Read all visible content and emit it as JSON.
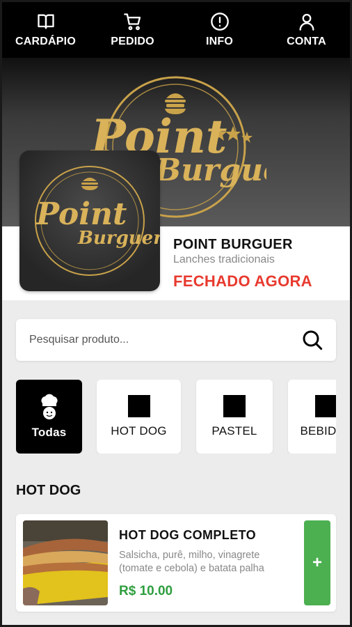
{
  "nav": [
    {
      "label": "CARDÁPIO",
      "icon": "book-icon"
    },
    {
      "label": "PEDIDO",
      "icon": "cart-icon"
    },
    {
      "label": "INFO",
      "icon": "info-icon"
    },
    {
      "label": "CONTA",
      "icon": "user-icon"
    }
  ],
  "logo": {
    "line1": "Point",
    "line2": "Burguer"
  },
  "store": {
    "name": "POINT BURGUER",
    "subtitle": "Lanches tradicionais",
    "status": "FECHADO AGORA",
    "status_color": "#e83a2f"
  },
  "search": {
    "placeholder": "Pesquisar produto..."
  },
  "categories": [
    {
      "label": "Todas",
      "active": true
    },
    {
      "label": "HOT DOG",
      "active": false
    },
    {
      "label": "PASTEL",
      "active": false
    },
    {
      "label": "BEBIDAS",
      "active": false
    }
  ],
  "section": {
    "title": "HOT DOG"
  },
  "products": [
    {
      "name": "HOT DOG COMPLETO",
      "description": "Salsicha, purê, milho, vinagrete (tomate e cebola) e batata palha",
      "price": "R$ 10.00",
      "add_label": "+"
    }
  ],
  "colors": {
    "accent": "#4caf50",
    "price": "#2e9e3e",
    "gold": "#c9a24a",
    "nav_bg": "#000000"
  }
}
